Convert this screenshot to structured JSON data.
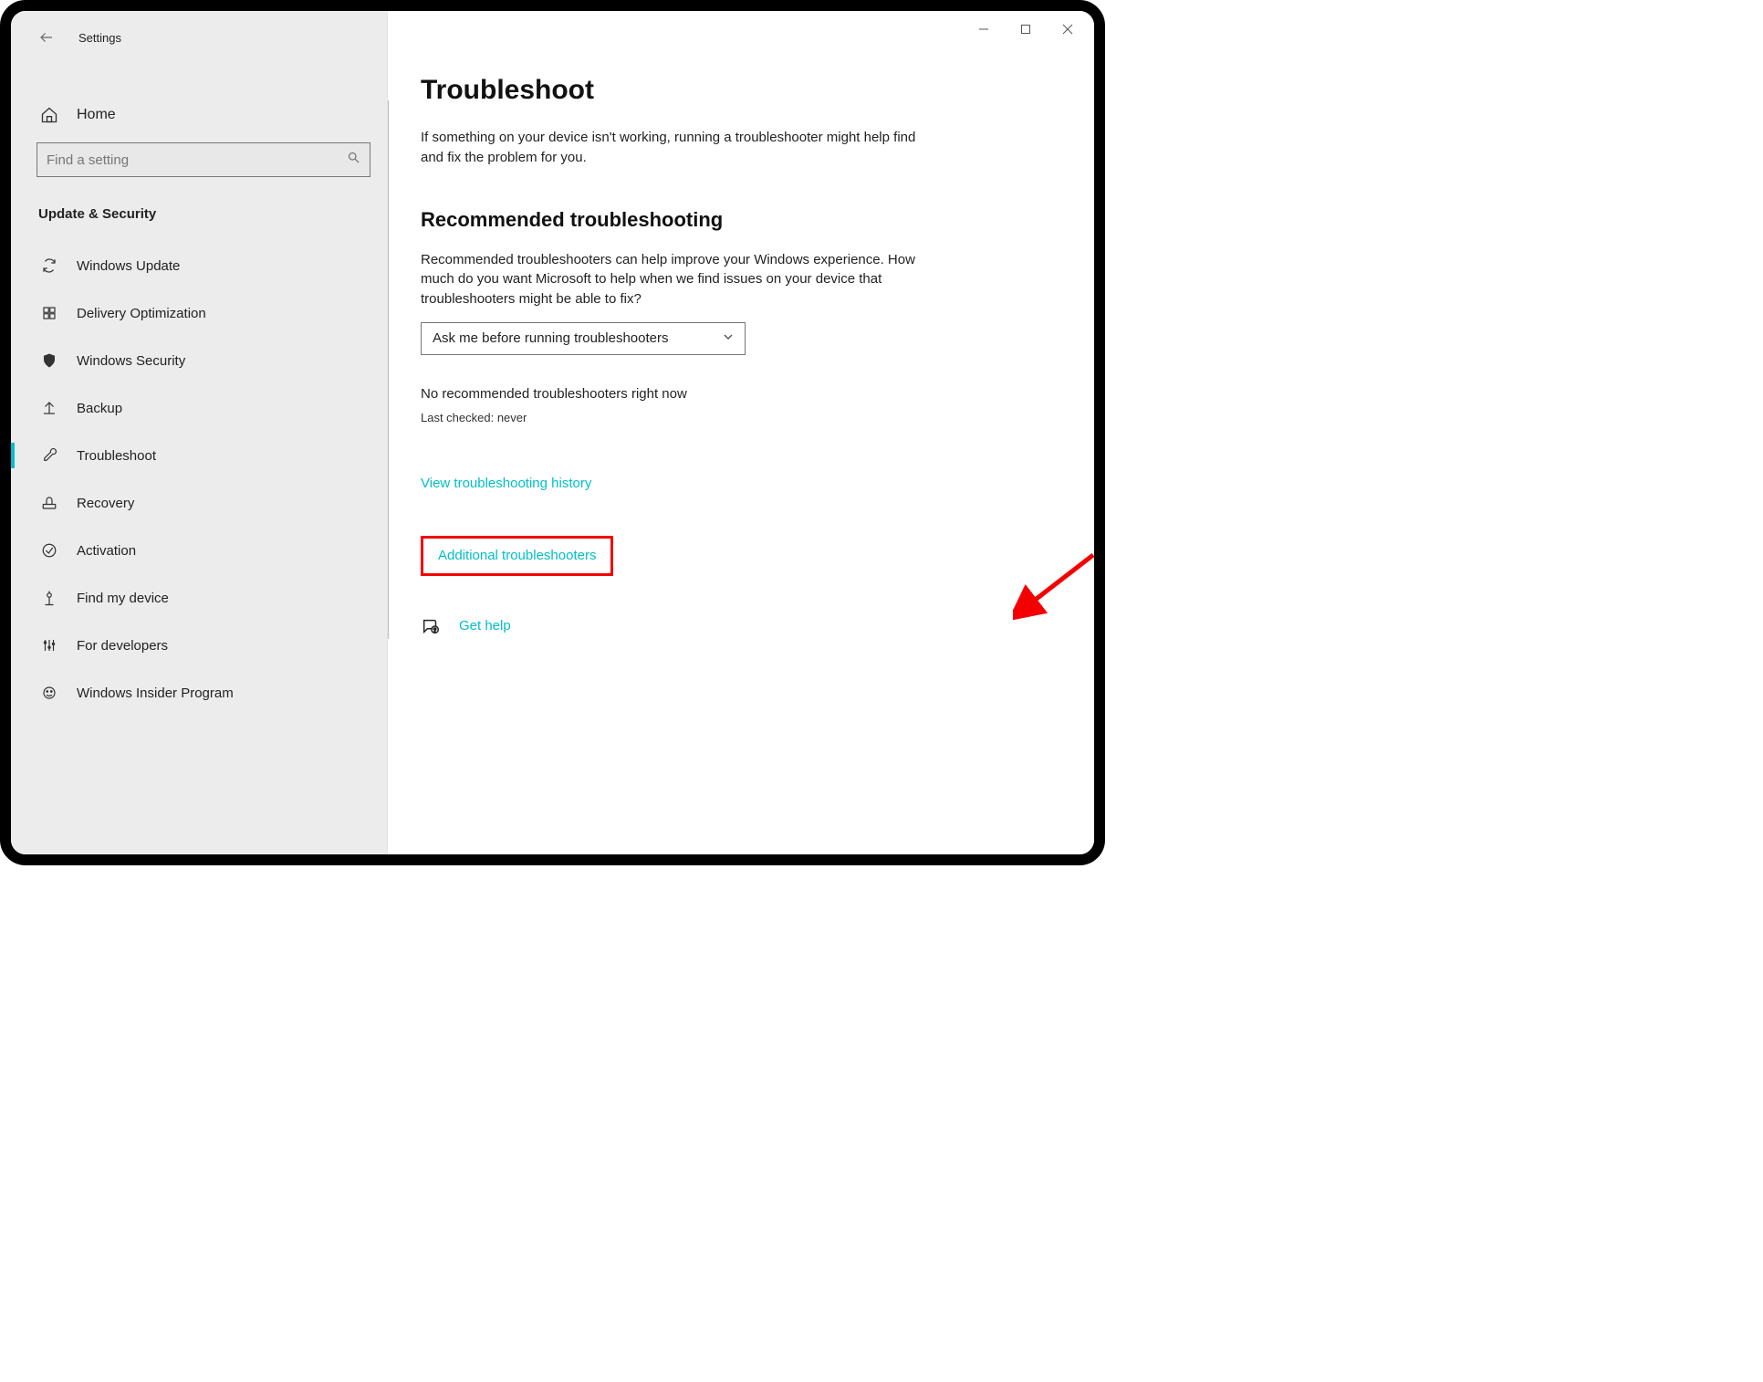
{
  "window": {
    "title": "Settings"
  },
  "sidebar": {
    "home": "Home",
    "search_placeholder": "Find a setting",
    "section": "Update & Security",
    "items": [
      {
        "label": "Windows Update"
      },
      {
        "label": "Delivery Optimization"
      },
      {
        "label": "Windows Security"
      },
      {
        "label": "Backup"
      },
      {
        "label": "Troubleshoot"
      },
      {
        "label": "Recovery"
      },
      {
        "label": "Activation"
      },
      {
        "label": "Find my device"
      },
      {
        "label": "For developers"
      },
      {
        "label": "Windows Insider Program"
      }
    ]
  },
  "main": {
    "title": "Troubleshoot",
    "intro": "If something on your device isn't working, running a troubleshooter might help find and fix the problem for you.",
    "rec_heading": "Recommended troubleshooting",
    "rec_body": "Recommended troubleshooters can help improve your Windows experience. How much do you want Microsoft to help when we find issues on your device that troubleshooters might be able to fix?",
    "dropdown_selected": "Ask me before running troubleshooters",
    "no_rec": "No recommended troubleshooters right now",
    "last_checked": "Last checked: never",
    "link_history": "View troubleshooting history",
    "link_additional": "Additional troubleshooters",
    "get_help": "Get help"
  }
}
